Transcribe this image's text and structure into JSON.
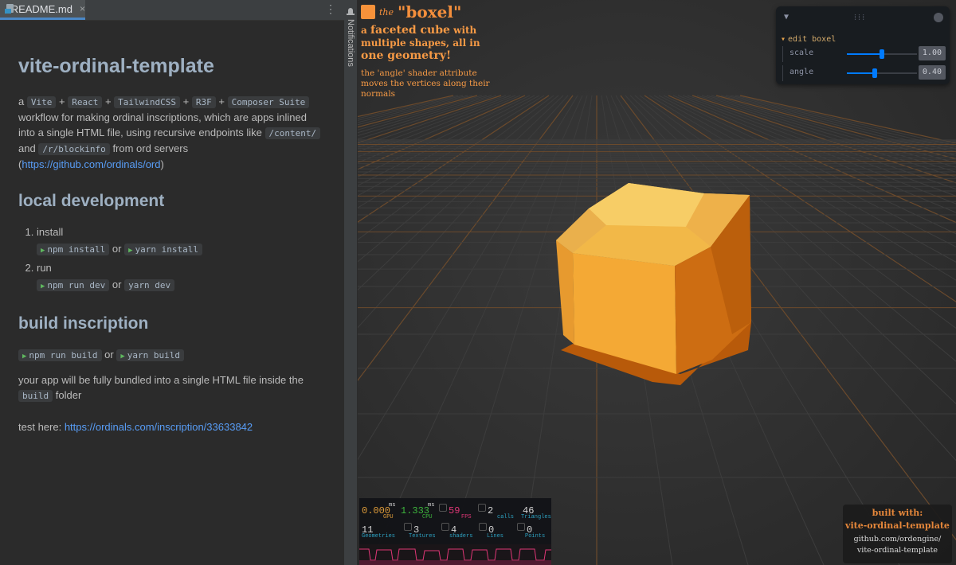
{
  "editor": {
    "tab": {
      "label": "README.md",
      "close": "×"
    },
    "menu_icon": "⋮",
    "doc": {
      "h1": "vite-ordinal-template",
      "intro": {
        "a": "a",
        "plus": "+",
        "tags": [
          "Vite",
          "React",
          "TailwindCSS",
          "R3F",
          "Composer Suite"
        ],
        "line2": "workflow for making ordinal inscriptions, which are apps inlined into a single HTML file, using recursive endpoints like",
        "code_content": "/content/",
        "and": "and",
        "code_blockinfo": "/r/blockinfo",
        "from": "from ord servers (",
        "link": "https://github.com/ordinals/ord",
        "close": ")"
      },
      "h2_local": "local development",
      "list": [
        {
          "label": "install",
          "cmd1": "npm install",
          "or": "or",
          "cmd2": "yarn install"
        },
        {
          "label": "run",
          "cmd1": "npm run dev",
          "or": "or",
          "cmd2": "yarn dev"
        }
      ],
      "h2_build": "build inscription",
      "build_cmd1": "npm run build",
      "build_or": "or",
      "build_cmd2": "yarn build",
      "bundle_text": "your app will be fully bundled into a single HTML file inside the",
      "bundle_code": "build",
      "bundle_folder": "folder",
      "test_label": "test here:",
      "test_link": "https://ordinals.com/inscription/33633842"
    }
  },
  "notifications": {
    "label": "Notifications",
    "icon": "bell-icon"
  },
  "viewport": {
    "overlay": {
      "the": "the",
      "title": "\"boxel\"",
      "desc1_a": "a",
      "desc1_b": "faceted cube",
      "desc1_c": "with multiple shapes, all in",
      "desc1_d": "one geometry!",
      "desc2": "the 'angle' shader attribute moves the vertices along their normals"
    },
    "panel": {
      "folder": "edit boxel",
      "controls": [
        {
          "label": "scale",
          "value": "1.00",
          "fraction": 0.5
        },
        {
          "label": "angle",
          "value": "0.40",
          "fraction": 0.4
        }
      ]
    },
    "perf": {
      "gpu": {
        "value": "0.000",
        "unit": "ms",
        "label": "GPU"
      },
      "cpu": {
        "value": "1.333",
        "unit": "ms",
        "label": "CPU"
      },
      "fps": {
        "value": "59",
        "label": "FPS"
      },
      "calls": {
        "value": "2",
        "label": "calls"
      },
      "triangles": {
        "value": "46",
        "label": "Triangles"
      },
      "geometries": {
        "value": "11",
        "label": "Geometries"
      },
      "textures": {
        "value": "3",
        "label": "Textures"
      },
      "shaders": {
        "value": "4",
        "label": "shaders"
      },
      "lines": {
        "value": "0",
        "label": "Lines"
      },
      "points": {
        "value": "0",
        "label": "Points"
      }
    },
    "built": {
      "heading": "built with:",
      "name": "vite-ordinal-template",
      "repo_line1": "github.com/ordengine/",
      "repo_line2": "vite-ordinal-template"
    }
  },
  "colors": {
    "accent_orange": "#f58f3c",
    "slider_blue": "#007bff",
    "link_blue": "#589df6",
    "gpu_orange": "#e8a23a",
    "cpu_green": "#3fbf3f",
    "fps_pink": "#e8377a",
    "cube_top": "#f7c45a",
    "cube_front": "#f5a93a",
    "cube_side": "#c8650f"
  }
}
